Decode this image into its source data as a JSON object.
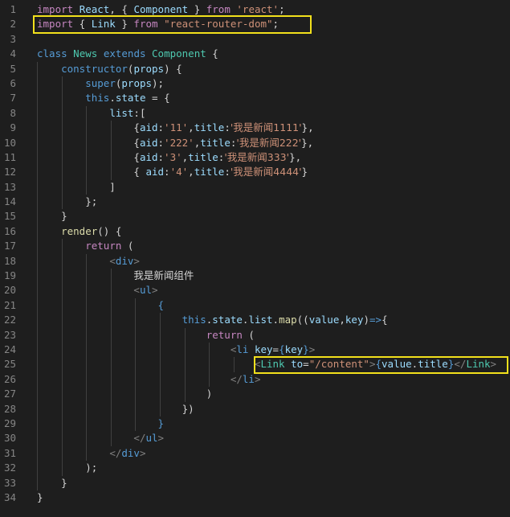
{
  "editor": {
    "line_numbers": [
      "1",
      "2",
      "3",
      "4",
      "5",
      "6",
      "7",
      "8",
      "9",
      "10",
      "11",
      "12",
      "13",
      "14",
      "15",
      "16",
      "17",
      "18",
      "19",
      "20",
      "21",
      "22",
      "23",
      "24",
      "25",
      "26",
      "27",
      "28",
      "29",
      "30",
      "31",
      "32",
      "33",
      "34"
    ],
    "colors": {
      "background": "#1e1e1e",
      "highlight_box": "#f2e01c",
      "keyword": "#569cd6",
      "control": "#c586c0",
      "class": "#4ec9b0",
      "string": "#ce9178",
      "variable": "#9cdcfe",
      "function": "#dcdcaa"
    },
    "lines": [
      [
        {
          "t": "import",
          "c": "ctl"
        },
        {
          "t": " "
        },
        {
          "t": "React",
          "c": "var"
        },
        {
          "t": ", { "
        },
        {
          "t": "Component",
          "c": "var"
        },
        {
          "t": " } "
        },
        {
          "t": "from",
          "c": "ctl"
        },
        {
          "t": " "
        },
        {
          "t": "'react'",
          "c": "str"
        },
        {
          "t": ";"
        }
      ],
      [
        {
          "t": "import",
          "c": "ctl"
        },
        {
          "t": " { "
        },
        {
          "t": "Link",
          "c": "var"
        },
        {
          "t": " } "
        },
        {
          "t": "from",
          "c": "ctl"
        },
        {
          "t": " "
        },
        {
          "t": "\"react-router-dom\"",
          "c": "str"
        },
        {
          "t": ";"
        }
      ],
      [],
      [
        {
          "t": "class",
          "c": "kw"
        },
        {
          "t": " "
        },
        {
          "t": "News",
          "c": "cls"
        },
        {
          "t": " "
        },
        {
          "t": "extends",
          "c": "kw"
        },
        {
          "t": " "
        },
        {
          "t": "Component",
          "c": "cls"
        },
        {
          "t": " {"
        }
      ],
      [
        {
          "t": "    "
        },
        {
          "t": "constructor",
          "c": "kw"
        },
        {
          "t": "("
        },
        {
          "t": "props",
          "c": "var"
        },
        {
          "t": ") {"
        }
      ],
      [
        {
          "t": "        "
        },
        {
          "t": "super",
          "c": "kw"
        },
        {
          "t": "("
        },
        {
          "t": "props",
          "c": "var"
        },
        {
          "t": ");"
        }
      ],
      [
        {
          "t": "        "
        },
        {
          "t": "this",
          "c": "kw"
        },
        {
          "t": "."
        },
        {
          "t": "state",
          "c": "var"
        },
        {
          "t": " = {"
        }
      ],
      [
        {
          "t": "            "
        },
        {
          "t": "list",
          "c": "var"
        },
        {
          "t": ":["
        }
      ],
      [
        {
          "t": "                {"
        },
        {
          "t": "aid",
          "c": "var"
        },
        {
          "t": ":"
        },
        {
          "t": "'11'",
          "c": "str"
        },
        {
          "t": ","
        },
        {
          "t": "title",
          "c": "var"
        },
        {
          "t": ":"
        },
        {
          "t": "'我是新闻1111'",
          "c": "str"
        },
        {
          "t": "},"
        }
      ],
      [
        {
          "t": "                {"
        },
        {
          "t": "aid",
          "c": "var"
        },
        {
          "t": ":"
        },
        {
          "t": "'222'",
          "c": "str"
        },
        {
          "t": ","
        },
        {
          "t": "title",
          "c": "var"
        },
        {
          "t": ":"
        },
        {
          "t": "'我是新闻222'",
          "c": "str"
        },
        {
          "t": "},"
        }
      ],
      [
        {
          "t": "                {"
        },
        {
          "t": "aid",
          "c": "var"
        },
        {
          "t": ":"
        },
        {
          "t": "'3'",
          "c": "str"
        },
        {
          "t": ","
        },
        {
          "t": "title",
          "c": "var"
        },
        {
          "t": ":"
        },
        {
          "t": "'我是新闻333'",
          "c": "str"
        },
        {
          "t": "},"
        }
      ],
      [
        {
          "t": "                { "
        },
        {
          "t": "aid",
          "c": "var"
        },
        {
          "t": ":"
        },
        {
          "t": "'4'",
          "c": "str"
        },
        {
          "t": ","
        },
        {
          "t": "title",
          "c": "var"
        },
        {
          "t": ":"
        },
        {
          "t": "'我是新闻4444'",
          "c": "str"
        },
        {
          "t": "}"
        }
      ],
      [
        {
          "t": "            ]"
        }
      ],
      [
        {
          "t": "        };"
        }
      ],
      [
        {
          "t": "    }"
        }
      ],
      [
        {
          "t": "    "
        },
        {
          "t": "render",
          "c": "fn"
        },
        {
          "t": "() {"
        }
      ],
      [
        {
          "t": "        "
        },
        {
          "t": "return",
          "c": "ctl"
        },
        {
          "t": " ("
        }
      ],
      [
        {
          "t": "            "
        },
        {
          "t": "<",
          "c": "tag"
        },
        {
          "t": "div",
          "c": "tagname"
        },
        {
          "t": ">",
          "c": "tag"
        }
      ],
      [
        {
          "t": "                "
        },
        {
          "t": "我是新闻组件",
          "c": "txt"
        }
      ],
      [
        {
          "t": "                "
        },
        {
          "t": "<",
          "c": "tag"
        },
        {
          "t": "ul",
          "c": "tagname"
        },
        {
          "t": ">",
          "c": "tag"
        }
      ],
      [
        {
          "t": "                    "
        },
        {
          "t": "{",
          "c": "kw"
        }
      ],
      [
        {
          "t": "                        "
        },
        {
          "t": "this",
          "c": "kw"
        },
        {
          "t": "."
        },
        {
          "t": "state",
          "c": "var"
        },
        {
          "t": "."
        },
        {
          "t": "list",
          "c": "var"
        },
        {
          "t": "."
        },
        {
          "t": "map",
          "c": "fn"
        },
        {
          "t": "(("
        },
        {
          "t": "value",
          "c": "var"
        },
        {
          "t": ","
        },
        {
          "t": "key",
          "c": "var"
        },
        {
          "t": ")"
        },
        {
          "t": "=>",
          "c": "kw"
        },
        {
          "t": "{"
        }
      ],
      [
        {
          "t": "                            "
        },
        {
          "t": "return",
          "c": "ctl"
        },
        {
          "t": " ("
        }
      ],
      [
        {
          "t": "                                "
        },
        {
          "t": "<",
          "c": "tag"
        },
        {
          "t": "li",
          "c": "tagname"
        },
        {
          "t": " "
        },
        {
          "t": "key",
          "c": "var"
        },
        {
          "t": "="
        },
        {
          "t": "{",
          "c": "kw"
        },
        {
          "t": "key",
          "c": "var"
        },
        {
          "t": "}",
          "c": "kw"
        },
        {
          "t": ">",
          "c": "tag"
        }
      ],
      [
        {
          "t": "                                    "
        },
        {
          "t": "<",
          "c": "tag"
        },
        {
          "t": "Link",
          "c": "cls"
        },
        {
          "t": " "
        },
        {
          "t": "to",
          "c": "var"
        },
        {
          "t": "="
        },
        {
          "t": "\"/content\"",
          "c": "str"
        },
        {
          "t": ">",
          "c": "tag"
        },
        {
          "t": "{",
          "c": "kw"
        },
        {
          "t": "value",
          "c": "var"
        },
        {
          "t": "."
        },
        {
          "t": "title",
          "c": "var"
        },
        {
          "t": "}",
          "c": "kw"
        },
        {
          "t": "</",
          "c": "tag"
        },
        {
          "t": "Link",
          "c": "cls"
        },
        {
          "t": ">",
          "c": "tag"
        }
      ],
      [
        {
          "t": "                                "
        },
        {
          "t": "</",
          "c": "tag"
        },
        {
          "t": "li",
          "c": "tagname"
        },
        {
          "t": ">",
          "c": "tag"
        }
      ],
      [
        {
          "t": "                            )"
        }
      ],
      [
        {
          "t": "                        })"
        }
      ],
      [
        {
          "t": "                    "
        },
        {
          "t": "}",
          "c": "kw"
        }
      ],
      [
        {
          "t": "                "
        },
        {
          "t": "</",
          "c": "tag"
        },
        {
          "t": "ul",
          "c": "tagname"
        },
        {
          "t": ">",
          "c": "tag"
        }
      ],
      [
        {
          "t": "            "
        },
        {
          "t": "</",
          "c": "tag"
        },
        {
          "t": "div",
          "c": "tagname"
        },
        {
          "t": ">",
          "c": "tag"
        }
      ],
      [
        {
          "t": "        );"
        }
      ],
      [
        {
          "t": "    }"
        }
      ],
      [
        {
          "t": "}"
        }
      ]
    ]
  }
}
